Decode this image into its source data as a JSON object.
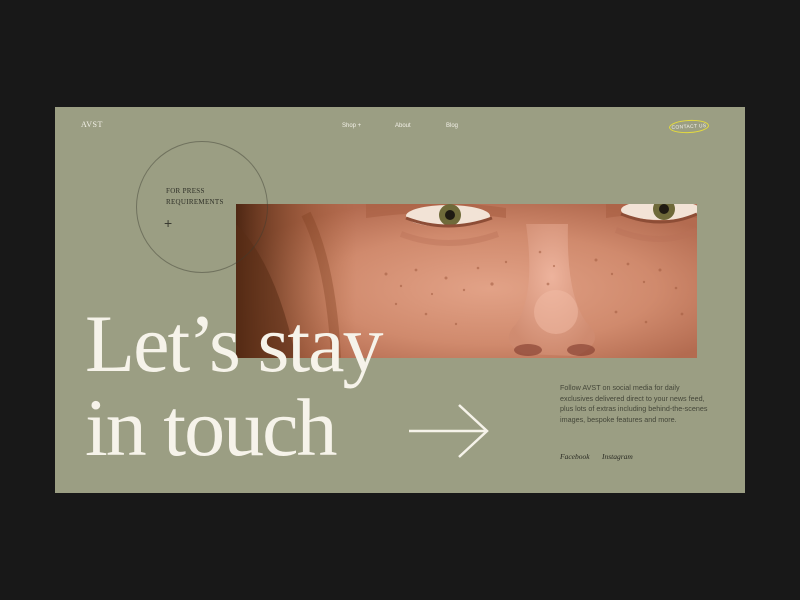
{
  "brand": {
    "logo": "AVST"
  },
  "nav": {
    "items": [
      "Shop +",
      "About",
      "Blog"
    ],
    "contact_label": "CONTACT US"
  },
  "press": {
    "line1": "FOR PRESS",
    "line2": "REQUIREMENTS",
    "icon": "plus-icon"
  },
  "hero": {
    "line1": "Let’s stay",
    "line2": "in touch",
    "arrow_icon": "arrow-right-icon"
  },
  "follow": {
    "text": "Follow AVST on social media for daily exclusives delivered direct to your news feed, plus lots of extras including behind-the-scenes images, bespoke features and more."
  },
  "social": [
    "Facebook",
    "Instagram"
  ],
  "colors": {
    "page_background": "#181818",
    "frame_background": "#9b9e83",
    "contact_outline": "#e6dc3c",
    "headline_text": "#f6f3ea"
  }
}
